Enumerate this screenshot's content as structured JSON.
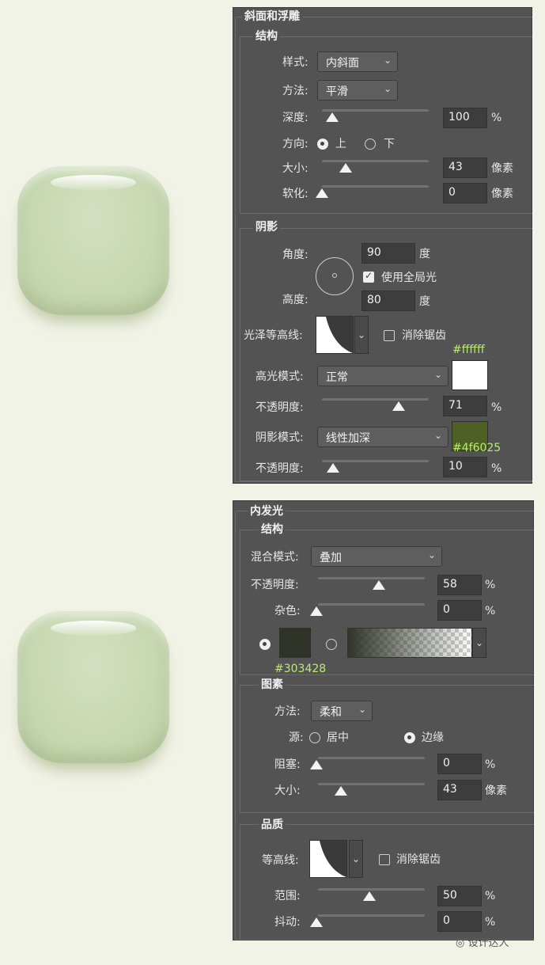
{
  "bevel": {
    "title": "斜面和浮雕",
    "structure": {
      "title": "结构",
      "style_label": "样式:",
      "style_value": "内斜面",
      "technique_label": "方法:",
      "technique_value": "平滑",
      "depth_label": "深度:",
      "depth_value": "100",
      "depth_unit": "%",
      "depth_slider": 0.03,
      "direction_label": "方向:",
      "direction_up": "上",
      "direction_down": "下",
      "direction_selected": "上",
      "size_label": "大小:",
      "size_value": "43",
      "size_unit": "像素",
      "size_slider": 0.2,
      "soften_label": "软化:",
      "soften_value": "0",
      "soften_unit": "像素",
      "soften_slider": 0.0
    },
    "shading": {
      "title": "阴影",
      "angle_label": "角度:",
      "angle_value": "90",
      "angle_unit": "度",
      "global_light_label": "使用全局光",
      "global_light_checked": true,
      "altitude_label": "高度:",
      "altitude_value": "80",
      "altitude_unit": "度",
      "gloss_contour_label": "光泽等高线:",
      "anti_alias_label": "消除锯齿",
      "anti_alias_checked": false,
      "highlight_hex": "#ffffff",
      "highlight_mode_label": "高光模式:",
      "highlight_mode_value": "正常",
      "highlight_color": "#ffffff",
      "highlight_opacity_label": "不透明度:",
      "highlight_opacity_value": "71",
      "highlight_opacity_unit": "%",
      "highlight_opacity_slider": 0.71,
      "shadow_mode_label": "阴影模式:",
      "shadow_mode_value": "线性加深",
      "shadow_color": "#4f6025",
      "shadow_hex": "#4f6025",
      "shadow_opacity_label": "不透明度:",
      "shadow_opacity_value": "10",
      "shadow_opacity_unit": "%",
      "shadow_opacity_slider": 0.1
    }
  },
  "inner_glow": {
    "title": "内发光",
    "structure": {
      "title": "结构",
      "blend_mode_label": "混合模式:",
      "blend_mode_value": "叠加",
      "opacity_label": "不透明度:",
      "opacity_value": "58",
      "opacity_unit": "%",
      "opacity_slider": 0.58,
      "noise_label": "杂色:",
      "noise_value": "0",
      "noise_unit": "%",
      "noise_slider": 0.0,
      "color": "#303428",
      "color_hex": "#303428"
    },
    "elements": {
      "title": "图素",
      "technique_label": "方法:",
      "technique_value": "柔和",
      "source_label": "源:",
      "source_center": "居中",
      "source_edge": "边缘",
      "source_selected": "边缘",
      "choke_label": "阻塞:",
      "choke_value": "0",
      "choke_unit": "%",
      "choke_slider": 0.0,
      "size_label": "大小:",
      "size_value": "43",
      "size_unit": "像素",
      "size_slider": 0.2
    },
    "quality": {
      "title": "品质",
      "contour_label": "等高线:",
      "anti_alias_label": "消除锯齿",
      "anti_alias_checked": false,
      "range_label": "范围:",
      "range_value": "50",
      "range_unit": "%",
      "range_slider": 0.5,
      "jitter_label": "抖动:",
      "jitter_value": "0",
      "jitter_unit": "%",
      "jitter_slider": 0.0
    }
  },
  "watermark": "设计达人",
  "colors": {
    "page_bg": "#f1f3e6",
    "panel_bg": "#535353",
    "tile": "#c8d8b2",
    "hex_text": "#b9ec6d"
  }
}
